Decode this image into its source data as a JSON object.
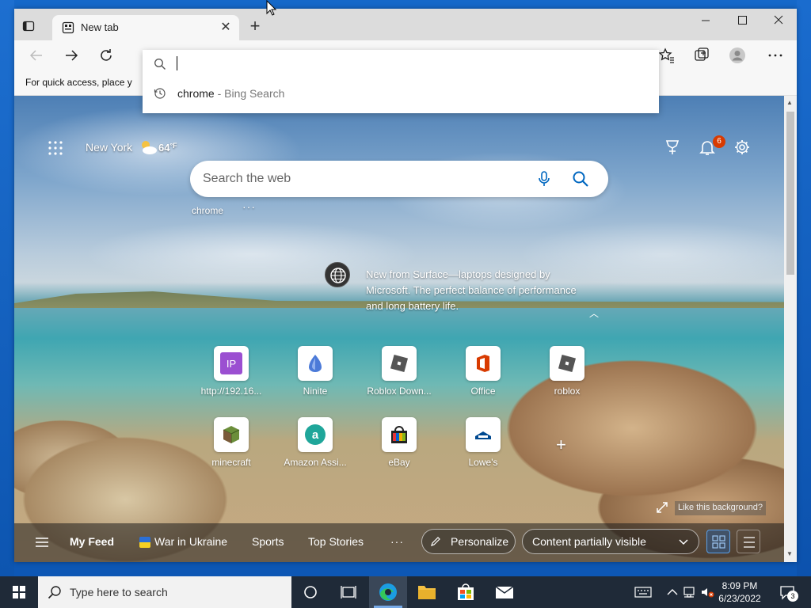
{
  "browser": {
    "tab_title": "New tab",
    "favorites_hint": "For quick access, place y",
    "omnibox": {
      "value": "",
      "suggestion_query": "chrome",
      "suggestion_source": " - Bing Search"
    }
  },
  "ntp": {
    "city": "New York",
    "temperature": "64",
    "temp_unit": "°F",
    "notification_count": "6",
    "search_placeholder": "Search the web",
    "recent_search": "chrome",
    "more_glyph": "···",
    "promo_text": "New from Surface—laptops designed by Microsoft. The perfect balance of performance and long battery life.",
    "quick_links": [
      {
        "label": "http://192.16...",
        "icon": "ip-icon"
      },
      {
        "label": "Ninite",
        "icon": "ninite-icon"
      },
      {
        "label": "Roblox Down...",
        "icon": "roblox-icon"
      },
      {
        "label": "Office",
        "icon": "office-icon"
      },
      {
        "label": "roblox",
        "icon": "roblox-icon"
      },
      {
        "label": "minecraft",
        "icon": "minecraft-icon"
      },
      {
        "label": "Amazon Assi...",
        "icon": "amazon-icon"
      },
      {
        "label": "eBay",
        "icon": "ebay-icon"
      },
      {
        "label": "Lowe's",
        "icon": "lowes-icon"
      }
    ],
    "like_background": "Like this background?",
    "feed": {
      "my_feed": "My Feed",
      "war_in_ukraine": "War in Ukraine",
      "sports": "Sports",
      "top_stories": "Top Stories",
      "more": "···",
      "personalize": "Personalize",
      "content_visibility": "Content partially visible"
    }
  },
  "taskbar": {
    "search_placeholder": "Type here to search",
    "time": "8:09 PM",
    "date": "6/23/2022",
    "notification_count": "3"
  },
  "colors": {
    "taskbar_bg": "#1f2a38",
    "notification_badge": "#d83b01",
    "accent": "#0067c0"
  }
}
